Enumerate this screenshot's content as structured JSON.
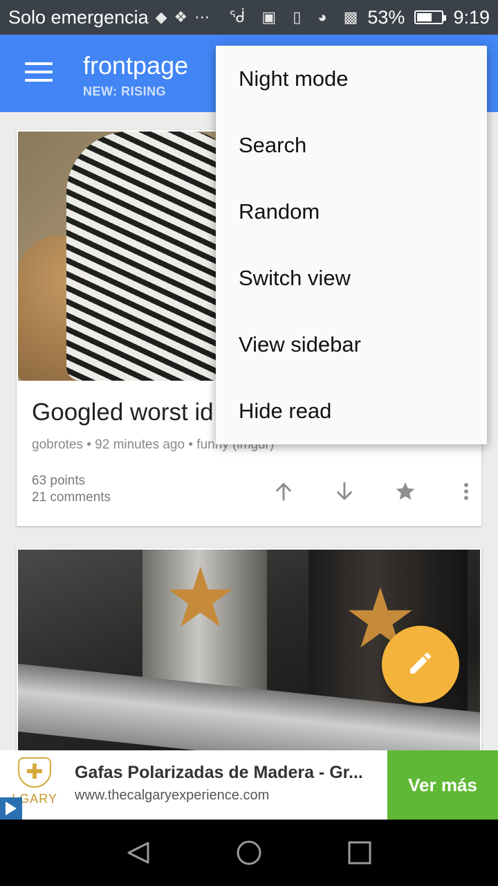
{
  "status_bar": {
    "carrier": "Solo emergencia",
    "battery_percent": "53%",
    "battery_level": 0.53,
    "time": "9:19",
    "icons": [
      "notification-icon",
      "diamond-icon",
      "more-dots-icon",
      "bluetooth-icon",
      "nfc-icon",
      "vibrate-icon",
      "wifi-icon",
      "data-icon",
      "battery-icon"
    ]
  },
  "app_bar": {
    "title": "frontpage",
    "subtitle": "NEW: RISING",
    "color": "#4285f4"
  },
  "menu": {
    "items": [
      {
        "label": "Night mode"
      },
      {
        "label": "Search"
      },
      {
        "label": "Random"
      },
      {
        "label": "Switch view"
      },
      {
        "label": "View sidebar"
      },
      {
        "label": "Hide read"
      }
    ]
  },
  "post": {
    "title": "Googled worst id",
    "meta": "gobrotes • 92 minutes ago • funny (imgur)",
    "points": "63 points",
    "comments": "21 comments",
    "actions": [
      "upvote-icon",
      "downvote-icon",
      "star-icon",
      "overflow-icon"
    ]
  },
  "fab": {
    "icon": "pencil-icon",
    "color": "#f4b43b"
  },
  "ad": {
    "brand": "LGARY",
    "title": "Gafas Polarizadas de Madera - Gr...",
    "url": "www.thecalgaryexperience.com",
    "cta": "Ver más",
    "cta_color": "#5fb936"
  },
  "nav": {
    "buttons": [
      "back-icon",
      "home-icon",
      "recents-icon"
    ]
  }
}
